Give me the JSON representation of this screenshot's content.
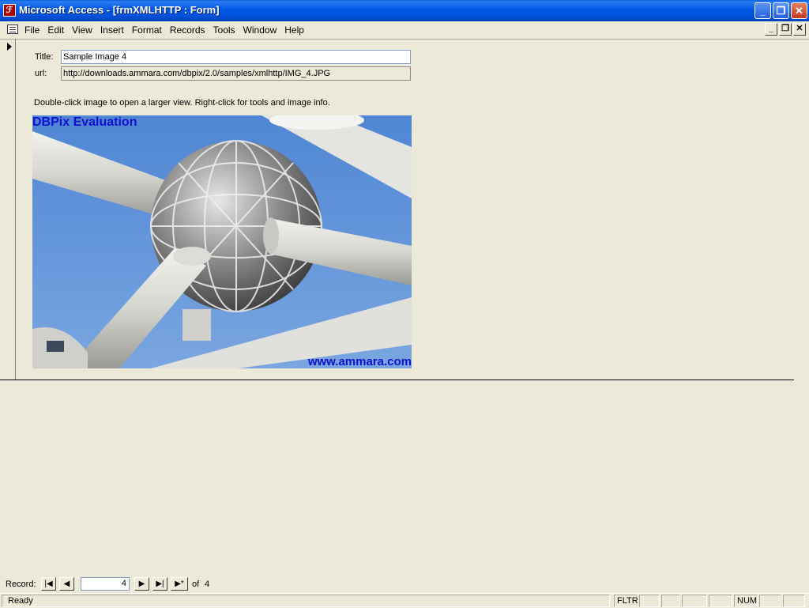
{
  "window": {
    "title": "Microsoft Access - [frmXMLHTTP : Form]",
    "icon": "access-key-icon",
    "buttons": {
      "minimize": "_",
      "restore": "❐",
      "close": "✕"
    }
  },
  "menu": {
    "items": [
      "File",
      "Edit",
      "View",
      "Insert",
      "Format",
      "Records",
      "Tools",
      "Window",
      "Help"
    ],
    "mdi_buttons": {
      "minimize": "_",
      "restore": "❐",
      "close": "✕"
    }
  },
  "form": {
    "title_label": "Title:",
    "title_value": "Sample Image 4",
    "url_label": "url:",
    "url_value": "http://downloads.ammara.com/dbpix/2.0/samples/xmlhttp/IMG_4.JPG",
    "hint": "Double-click image to open a larger view.  Right-click for tools and image info.",
    "image": {
      "description_icon": "atomium-sphere-photo",
      "watermark_top": "DBPix Evaluation",
      "watermark_bottom": "www.ammara.com",
      "watermark_color": "#1010d0"
    }
  },
  "navigation": {
    "label": "Record:",
    "first": "|◀",
    "prev": "◀",
    "current": "4",
    "next": "▶",
    "last": "▶|",
    "new": "▶*",
    "of_label": "of",
    "total": "4"
  },
  "status": {
    "text": "Ready",
    "panels": [
      "FLTR",
      "",
      "",
      "",
      "",
      "NUM",
      "",
      ""
    ]
  },
  "colors": {
    "titlebar": "#0058e6",
    "face": "#ece9d8",
    "sky": "#5c8fd6"
  }
}
